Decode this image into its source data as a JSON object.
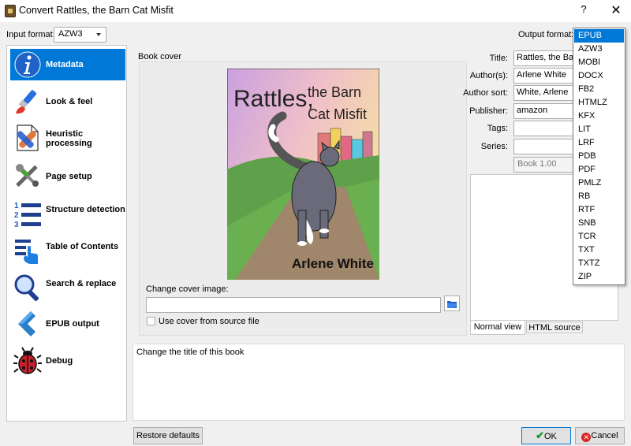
{
  "window": {
    "title": "Convert Rattles, the Barn Cat Misfit",
    "help": "?",
    "close": "✕"
  },
  "input_format": {
    "label": "Input format:",
    "value": "AZW3"
  },
  "output_format": {
    "label": "Output format:"
  },
  "sidebar": {
    "items": [
      {
        "label": "Metadata",
        "icon": "info-icon"
      },
      {
        "label": "Look & feel",
        "icon": "brush-icon"
      },
      {
        "label": "Heuristic processing",
        "icon": "bandage-document-icon"
      },
      {
        "label": "Page setup",
        "icon": "tools-icon"
      },
      {
        "label": "Structure detection",
        "icon": "numbered-list-icon"
      },
      {
        "label": "Table of Contents",
        "icon": "toc-icon"
      },
      {
        "label": "Search & replace",
        "icon": "magnifier-icon"
      },
      {
        "label": "EPUB output",
        "icon": "chevron-left-icon"
      },
      {
        "label": "Debug",
        "icon": "bug-icon"
      }
    ]
  },
  "cover": {
    "group_label": "Book cover",
    "title_line1": "Rattles,",
    "title_line1b": "the Barn",
    "title_line2": "Cat Misfit",
    "author": "Arlene White",
    "change_label": "Change cover image:",
    "path_value": "",
    "use_source_label": "Use cover from source file"
  },
  "meta": {
    "title_label": "Title:",
    "title_value": "Rattles, the Barn Cat Misfit",
    "author_label": "Author(s):",
    "author_value": "Arlene White",
    "author_sort_label": "Author sort:",
    "author_sort_value": "White, Arlene",
    "publisher_label": "Publisher:",
    "publisher_value": "amazon",
    "tags_label": "Tags:",
    "tags_value": "",
    "series_label": "Series:",
    "series_value": "",
    "series_index": "Book 1.00"
  },
  "comments_tabs": {
    "normal": "Normal view",
    "html": "HTML source"
  },
  "help_text": "Change the title of this book",
  "buttons": {
    "restore": "Restore defaults",
    "ok": "OK",
    "cancel": "Cancel"
  },
  "output_options": [
    "EPUB",
    "AZW3",
    "MOBI",
    "DOCX",
    "FB2",
    "HTMLZ",
    "KFX",
    "LIT",
    "LRF",
    "PDB",
    "PDF",
    "PMLZ",
    "RB",
    "RTF",
    "SNB",
    "TCR",
    "TXT",
    "TXTZ",
    "ZIP"
  ],
  "output_selected": "EPUB",
  "colors": {
    "accent": "#0078d7",
    "ok_check": "#1a9a2a",
    "cancel_x": "#d62828"
  }
}
